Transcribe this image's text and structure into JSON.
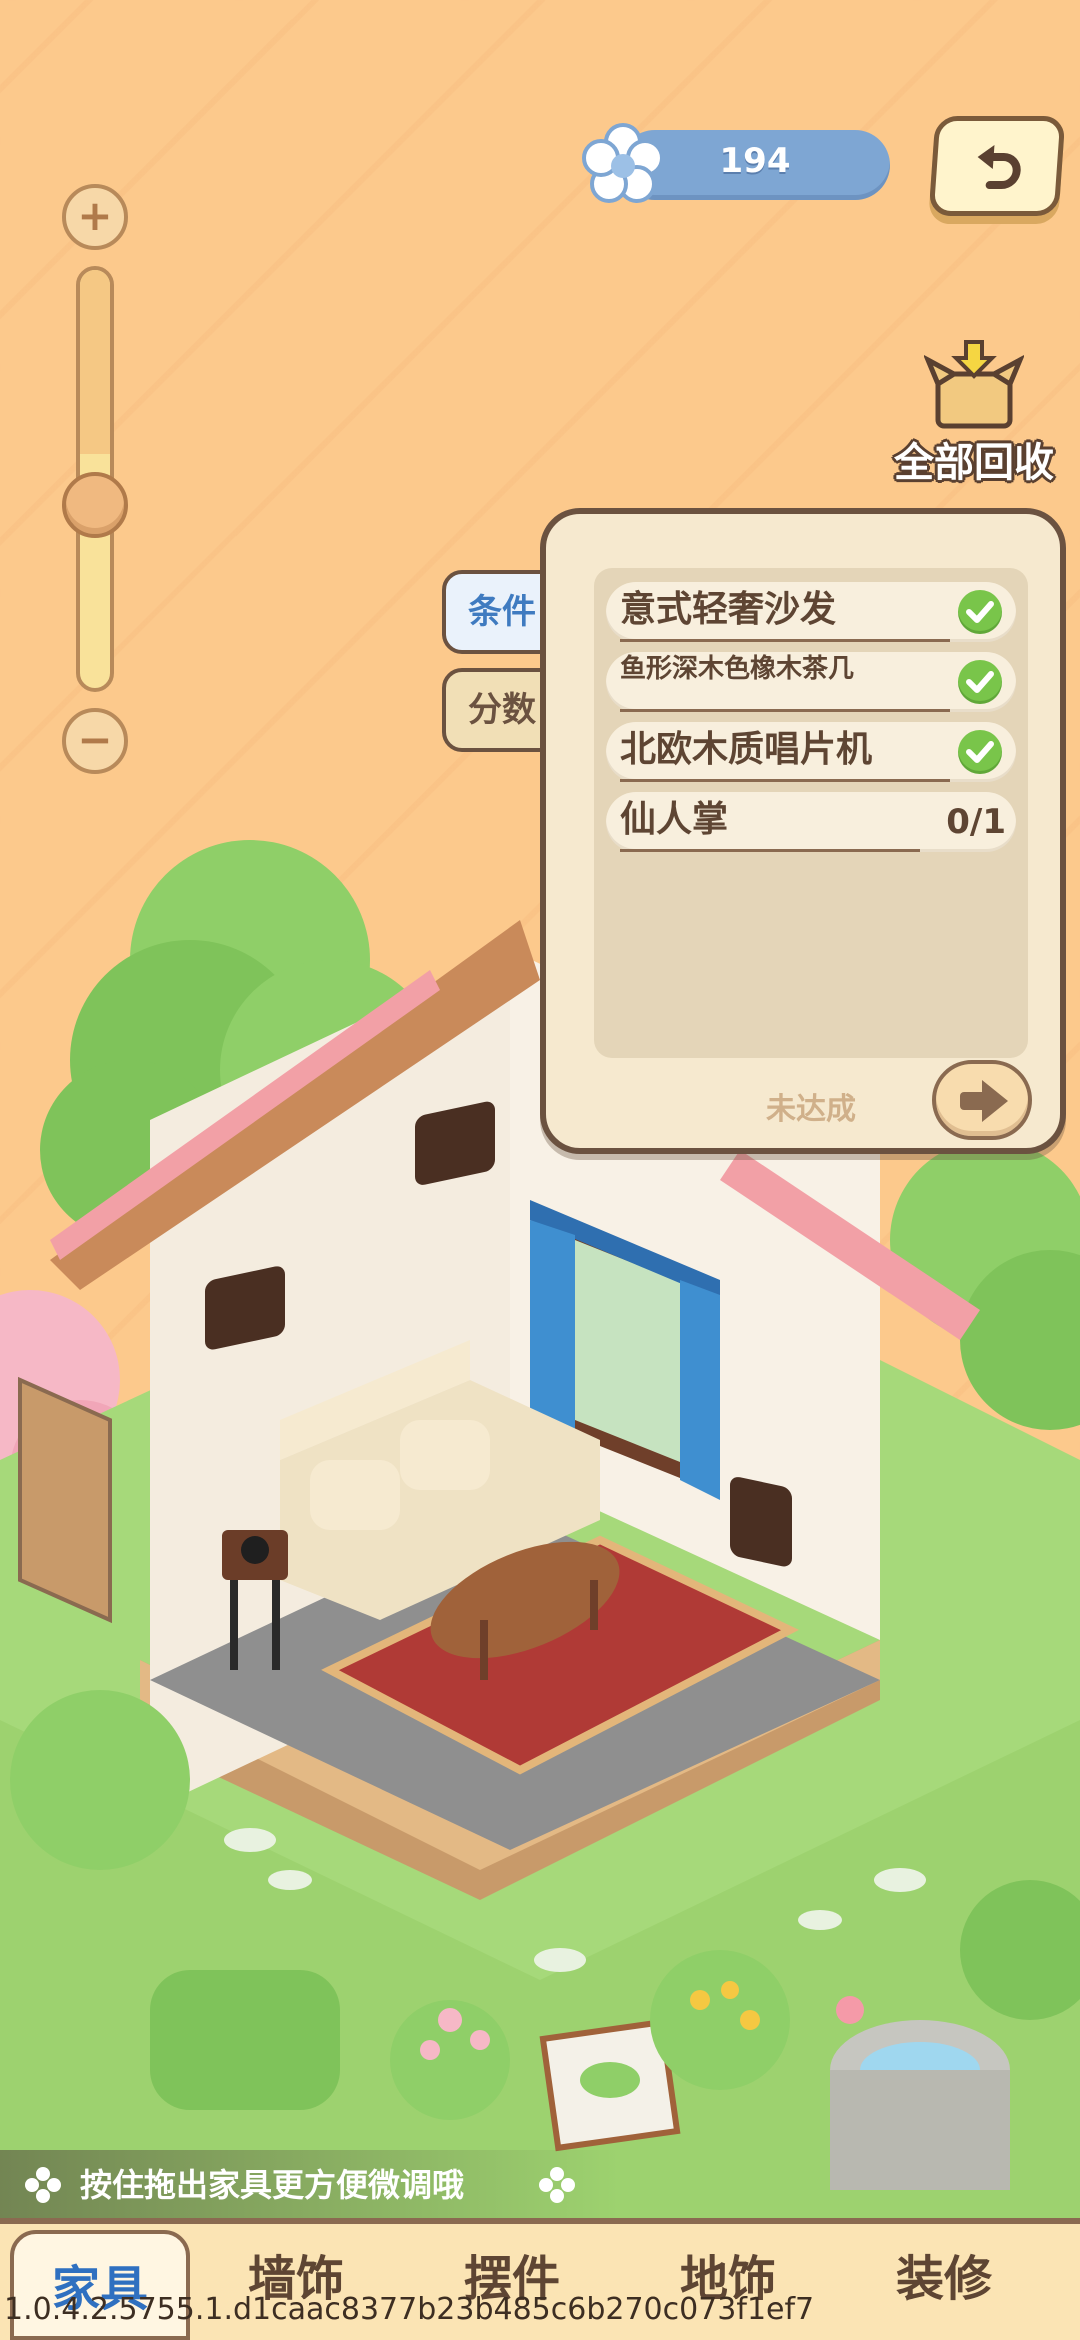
{
  "currency": {
    "amount": "194",
    "icon": "flower-icon"
  },
  "zoom": {
    "plus": "+",
    "minus": "−",
    "level_fraction": 0.38
  },
  "recycle_all": {
    "label": "全部回收"
  },
  "panel": {
    "tabs": [
      {
        "label": "条件",
        "active": true
      },
      {
        "label": "分数",
        "active": false
      }
    ],
    "requirements": [
      {
        "name": "意式轻奢沙发",
        "done": true
      },
      {
        "name": "鱼形深木色橡木茶几",
        "done": true
      },
      {
        "name": "北欧木质唱片机",
        "done": true
      },
      {
        "name": "仙人掌",
        "done": false,
        "progress": "0/1"
      }
    ],
    "status": "未达成"
  },
  "hint": {
    "text": "按住拖出家具更方便微调哦"
  },
  "bottom_tabs": [
    {
      "label": "家具",
      "active": true
    },
    {
      "label": "墙饰",
      "active": false
    },
    {
      "label": "摆件",
      "active": false
    },
    {
      "label": "地饰",
      "active": false
    },
    {
      "label": "装修",
      "active": false
    }
  ],
  "version": "1.0.4.2.5755.1.d1caac8377b23b485c6b270c073f1ef7",
  "colors": {
    "accent_blue": "#3f7bc0",
    "check_green": "#79c54a",
    "brown": "#6b5240"
  }
}
